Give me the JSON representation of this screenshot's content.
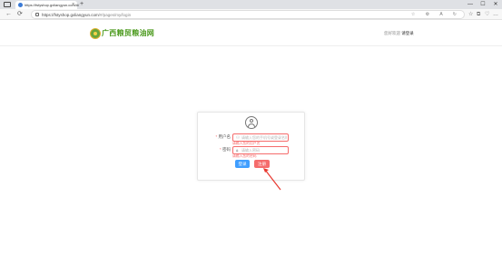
{
  "browser": {
    "tab_title": "https://fstyshop.gxliangyun.com/#/",
    "tab_close": "×",
    "new_tab": "+",
    "window_controls": [
      "—",
      "☐",
      "✕"
    ],
    "nav_buttons": [
      "←",
      "⟳"
    ],
    "url_host": "https://fstyshop.gxliangyun.com",
    "url_path": "/#/pages/my/login",
    "addr_icons": "☆ ⚙ A ↻",
    "toolbar_icons": [
      "☆",
      "⧉",
      "♡",
      "…"
    ]
  },
  "header": {
    "logo_text": "广西粮贸粮油网",
    "links_prefix": "您好欢迎 ",
    "login_link": "请登录"
  },
  "login": {
    "username_label": "用户名",
    "username_required": "*",
    "username_placeholder": "请输入您的手机号或登录名称",
    "username_error": "请输入您的用户名",
    "password_label": "密码",
    "password_required": "*",
    "password_placeholder": "请输入密码",
    "password_error": "请输入您的密码",
    "login_button": "登录",
    "register_button": "注册"
  },
  "colors": {
    "brand_green": "#4c9a1e",
    "error_red": "#f56c6c",
    "primary_blue": "#409eff",
    "annotation_arrow": "#e8382f"
  },
  "icons": {
    "user_icon": "user-icon",
    "lock_icon": "lock-icon",
    "avatar_icon": "avatar-icon"
  }
}
